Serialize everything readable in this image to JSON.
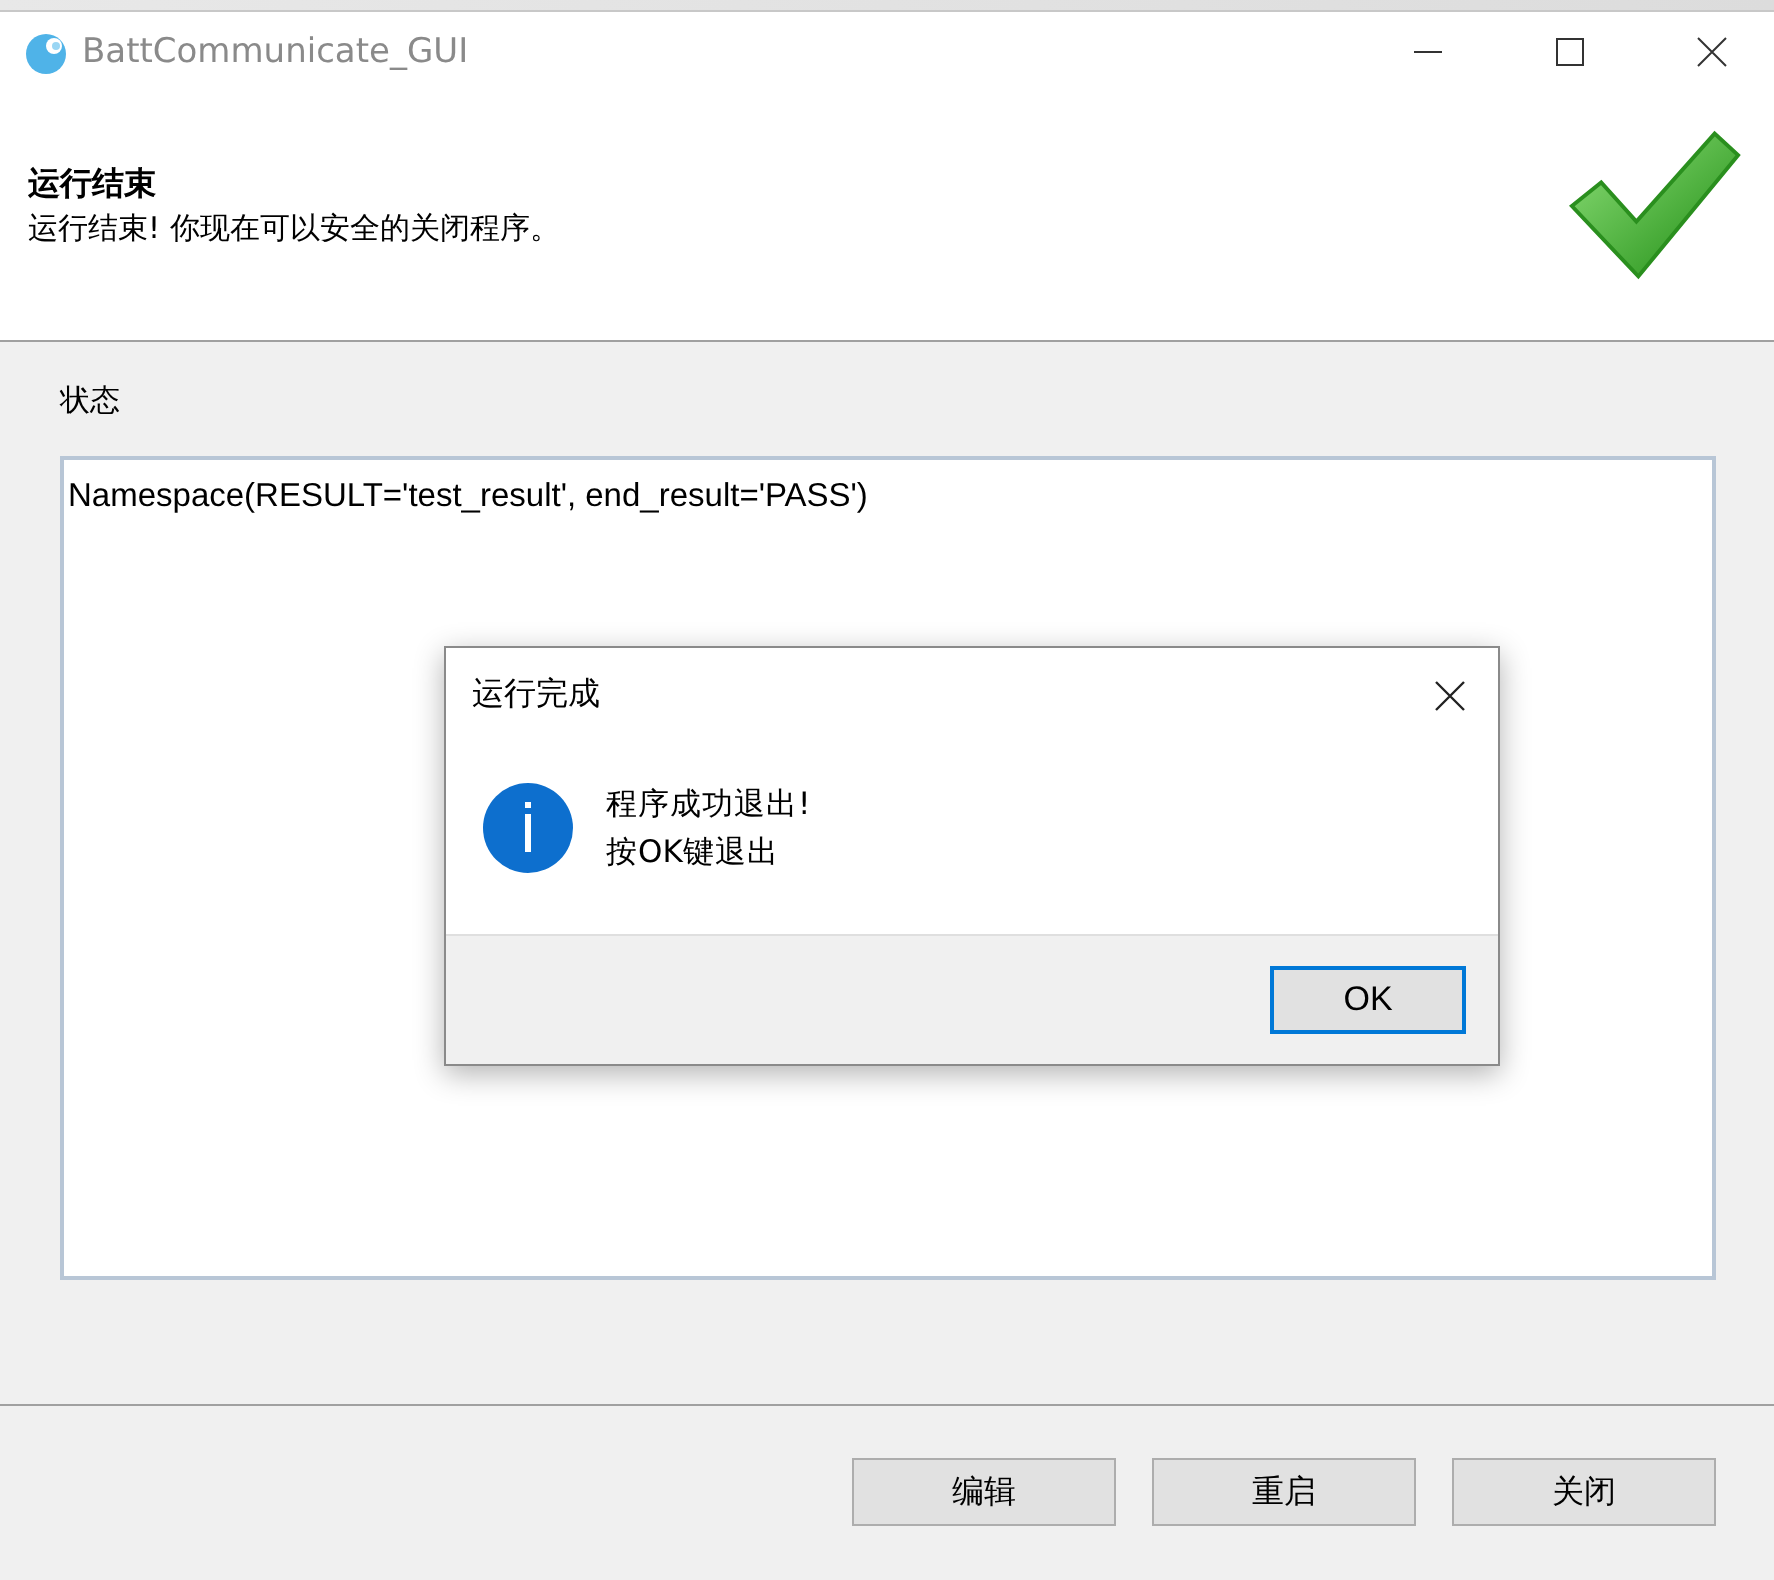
{
  "window": {
    "title": "BattCommunicate_GUI"
  },
  "header": {
    "title": "运行结束",
    "message": "运行结束! 你现在可以安全的关闭程序。"
  },
  "status": {
    "label": "状态",
    "text": "Namespace(RESULT='test_result', end_result='PASS')"
  },
  "buttons": [
    {
      "label": "编辑"
    },
    {
      "label": "重启"
    },
    {
      "label": "关闭"
    }
  ],
  "dialog": {
    "title": "运行完成",
    "lines": [
      "程序成功退出!",
      "按OK键退出"
    ],
    "button": {
      "label": "OK",
      "focused": true
    }
  }
}
